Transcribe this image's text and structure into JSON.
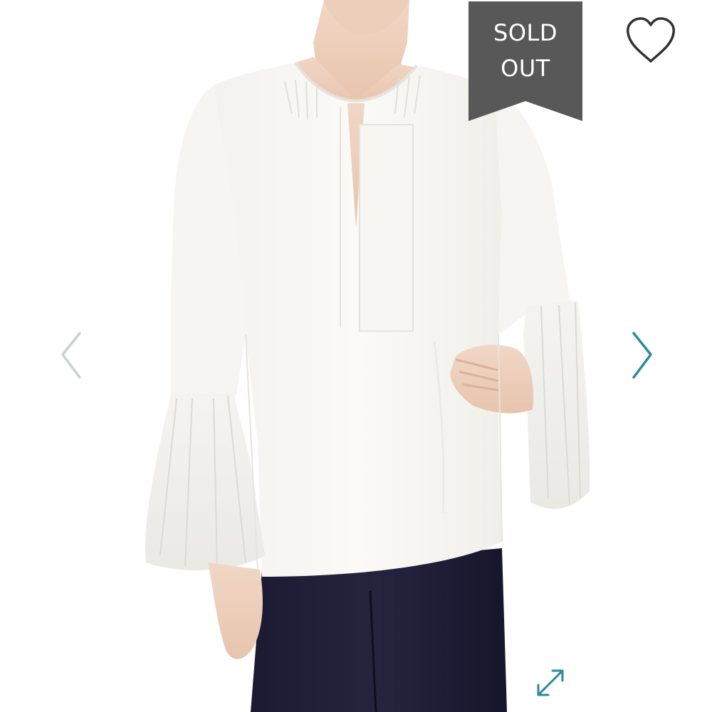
{
  "product": {
    "image_description_icon": "white-bell-sleeve-blouse-photo"
  },
  "badge": {
    "line1": "SOLD",
    "line2": "OUT",
    "background_color": "#585858",
    "text_color": "#ffffff"
  },
  "icons": {
    "like": "heart-outline-icon",
    "previous": "chevron-left-icon",
    "next": "chevron-right-icon",
    "expand": "expand-arrows-icon"
  },
  "colors": {
    "nav_prev": "#c9cfd2",
    "nav_next": "#2d8a9a",
    "expand": "#2d8a9a",
    "heart": "#333333"
  }
}
